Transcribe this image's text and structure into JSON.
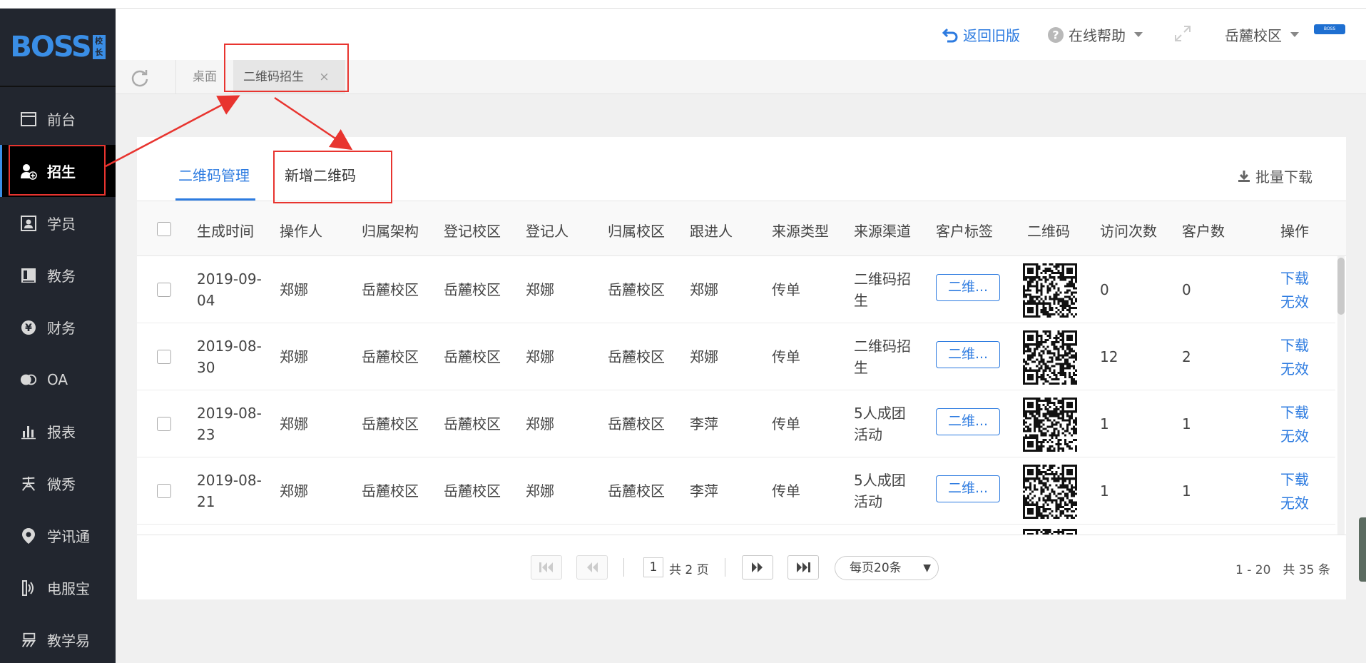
{
  "sidebar": {
    "logo_text": "BOSS",
    "logo_badge": "校长",
    "items": [
      {
        "label": "前台",
        "icon": "window-icon"
      },
      {
        "label": "招生",
        "icon": "add-user-icon",
        "active": true
      },
      {
        "label": "学员",
        "icon": "student-card-icon"
      },
      {
        "label": "教务",
        "icon": "book-icon"
      },
      {
        "label": "财务",
        "icon": "yen-coin-icon"
      },
      {
        "label": "OA",
        "icon": "chat-bubbles-icon"
      },
      {
        "label": "报表",
        "icon": "bar-chart-icon"
      },
      {
        "label": "微秀",
        "icon": "xiu-glyph-icon"
      },
      {
        "label": "学讯通",
        "icon": "location-pin-icon"
      },
      {
        "label": "电服宝",
        "icon": "phone-signal-icon"
      },
      {
        "label": "教学易",
        "icon": "yi-glyph-icon"
      }
    ]
  },
  "header": {
    "back_label": "返回旧版",
    "help_label": "在线帮助",
    "campus_label": "岳麓校区",
    "avatar_text": "BOSS"
  },
  "tabs": {
    "desk": "桌面",
    "current": "二维码招生",
    "close": "×"
  },
  "subtabs": {
    "manage": "二维码管理",
    "new": "新增二维码",
    "bulk_download": "批量下载"
  },
  "table": {
    "columns": [
      "生成时间",
      "操作人",
      "归属架构",
      "登记校区",
      "登记人",
      "归属校区",
      "跟进人",
      "来源类型",
      "来源渠道",
      "客户标签",
      "二维码",
      "访问次数",
      "客户数",
      "操作"
    ],
    "rows": [
      {
        "date1": "2019-09-",
        "date2": "04",
        "operator": "郑娜",
        "org": "岳麓校区",
        "reg_campus": "岳麓校区",
        "registrar": "郑娜",
        "campus": "岳麓校区",
        "follower": "郑娜",
        "source_type": "传单",
        "channel1": "二维码招",
        "channel2": "生",
        "tag": "二维...",
        "visits": "0",
        "customers": "0",
        "action1": "下载",
        "action2": "无效"
      },
      {
        "date1": "2019-08-",
        "date2": "30",
        "operator": "郑娜",
        "org": "岳麓校区",
        "reg_campus": "岳麓校区",
        "registrar": "郑娜",
        "campus": "岳麓校区",
        "follower": "郑娜",
        "source_type": "传单",
        "channel1": "二维码招",
        "channel2": "生",
        "tag": "二维...",
        "visits": "12",
        "customers": "2",
        "action1": "下载",
        "action2": "无效"
      },
      {
        "date1": "2019-08-",
        "date2": "23",
        "operator": "郑娜",
        "org": "岳麓校区",
        "reg_campus": "岳麓校区",
        "registrar": "郑娜",
        "campus": "岳麓校区",
        "follower": "李萍",
        "source_type": "传单",
        "channel1": "5人成团",
        "channel2": "活动",
        "tag": "二维...",
        "visits": "1",
        "customers": "1",
        "action1": "下载",
        "action2": "无效"
      },
      {
        "date1": "2019-08-",
        "date2": "21",
        "operator": "郑娜",
        "org": "岳麓校区",
        "reg_campus": "岳麓校区",
        "registrar": "郑娜",
        "campus": "岳麓校区",
        "follower": "李萍",
        "source_type": "传单",
        "channel1": "5人成团",
        "channel2": "活动",
        "tag": "二维...",
        "visits": "1",
        "customers": "1",
        "action1": "下载",
        "action2": "无效"
      }
    ]
  },
  "pagination": {
    "current_page": "1",
    "total_pages": "共 2 页",
    "per_page": "每页20条",
    "range": "1 - 20　共 35 条"
  },
  "colors": {
    "accent": "#2d7be0",
    "sidebar_bg": "#22262f",
    "annotation": "#e8342f"
  }
}
